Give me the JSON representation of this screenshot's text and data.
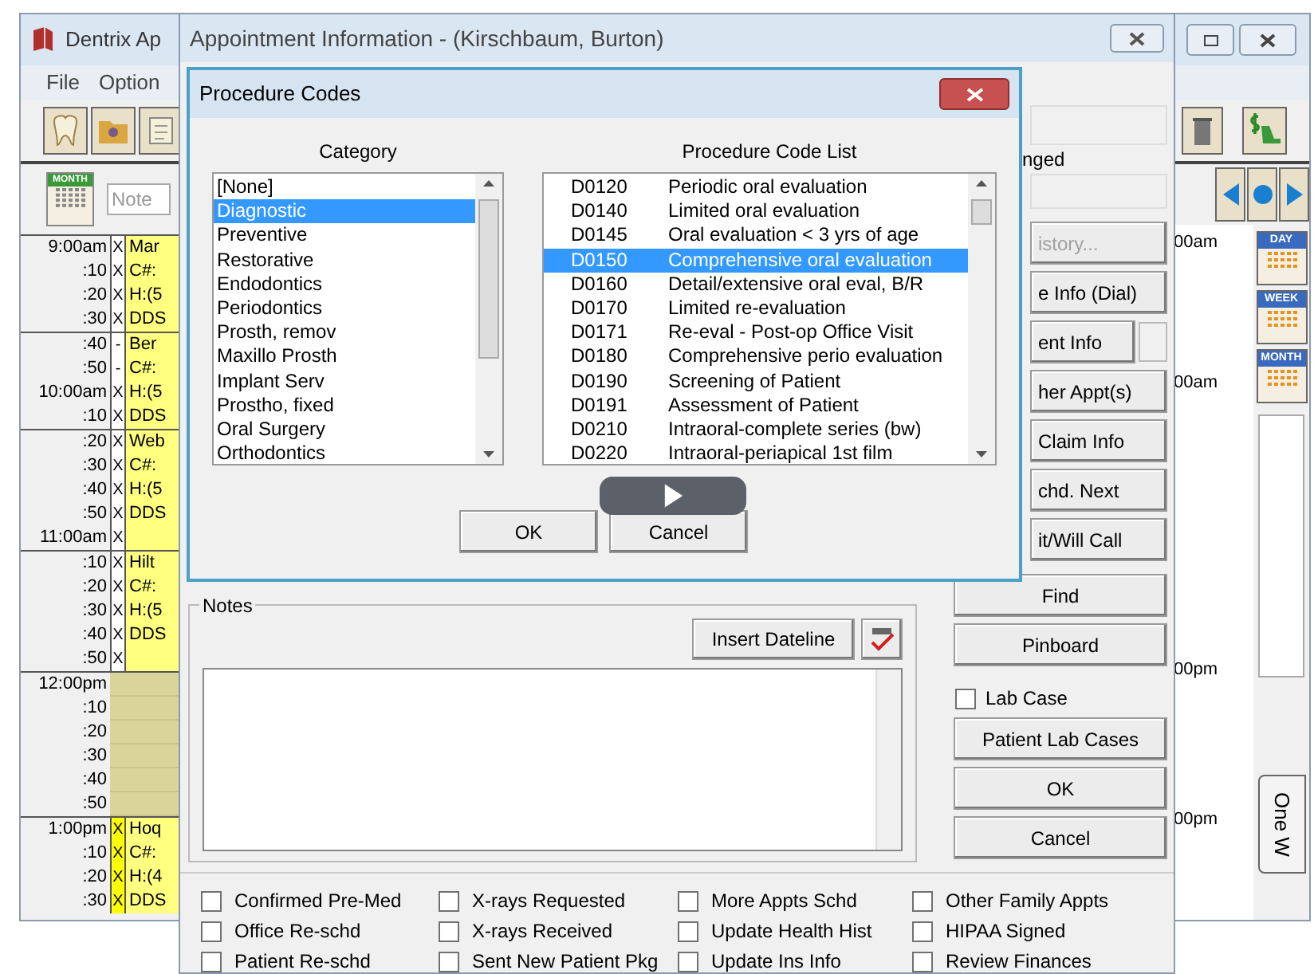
{
  "main_window": {
    "title": "Dentrix Ap",
    "menu": [
      "File",
      "Option"
    ],
    "month_button": "MONTH",
    "note_field": {
      "placeholder": "Note"
    },
    "schedule": [
      {
        "kind": "appt",
        "mark_highlight": false,
        "rows": [
          {
            "time": "9:00am",
            "mark": "X",
            "text": "Mar"
          },
          {
            "time": ":10",
            "mark": "X",
            "text": "C#:"
          },
          {
            "time": ":20",
            "mark": "X",
            "text": "H:(5"
          },
          {
            "time": ":30",
            "mark": "X",
            "text": "DDS"
          }
        ]
      },
      {
        "kind": "appt",
        "mark_highlight": false,
        "rows": [
          {
            "time": ":40",
            "mark": "-",
            "text": "Ber"
          },
          {
            "time": ":50",
            "mark": "-",
            "text": "C#:"
          },
          {
            "time": "10:00am",
            "mark": "X",
            "text": "H:(5"
          },
          {
            "time": ":10",
            "mark": "X",
            "text": "DDS"
          }
        ]
      },
      {
        "kind": "appt",
        "mark_highlight": false,
        "rows": [
          {
            "time": ":20",
            "mark": "X",
            "text": "Web"
          },
          {
            "time": ":30",
            "mark": "X",
            "text": "C#:"
          },
          {
            "time": ":40",
            "mark": "X",
            "text": "H:(5"
          },
          {
            "time": ":50",
            "mark": "X",
            "text": "DDS"
          },
          {
            "time": "11:00am",
            "mark": "X",
            "text": ""
          }
        ]
      },
      {
        "kind": "appt",
        "mark_highlight": false,
        "rows": [
          {
            "time": ":10",
            "mark": "X",
            "text": "Hilt"
          },
          {
            "time": ":20",
            "mark": "X",
            "text": "C#:"
          },
          {
            "time": ":30",
            "mark": "X",
            "text": "H:(5"
          },
          {
            "time": ":40",
            "mark": "X",
            "text": "DDS"
          },
          {
            "time": ":50",
            "mark": "X",
            "text": ""
          }
        ]
      },
      {
        "kind": "lunch",
        "rows": [
          {
            "time": "12:00pm",
            "mark": "",
            "text": ""
          },
          {
            "time": ":10",
            "mark": "",
            "text": ""
          },
          {
            "time": ":20",
            "mark": "",
            "text": ""
          },
          {
            "time": ":30",
            "mark": "",
            "text": ""
          },
          {
            "time": ":40",
            "mark": "",
            "text": ""
          },
          {
            "time": ":50",
            "mark": "",
            "text": ""
          }
        ]
      },
      {
        "kind": "appt",
        "mark_highlight": true,
        "rows": [
          {
            "time": "1:00pm",
            "mark": "X",
            "text": "Hoq"
          },
          {
            "time": ":10",
            "mark": "X",
            "text": "C#:"
          },
          {
            "time": ":20",
            "mark": "X",
            "text": "H:(4"
          },
          {
            "time": ":30",
            "mark": "X",
            "text": "DDS"
          }
        ]
      }
    ],
    "right_times": [
      "00am",
      "00am",
      "00pm",
      "00pm"
    ],
    "views": [
      "DAY",
      "WEEK",
      "MONTH"
    ],
    "tab": "One W"
  },
  "appointment_window": {
    "title": "Appointment Information - (Kirschbaum, Burton)",
    "partial_label": "nged",
    "buttons": [
      {
        "label": "istory...",
        "disabled": true
      },
      {
        "label": "e Info (Dial)",
        "disabled": false
      },
      {
        "label": "ent Info",
        "disabled": false
      },
      {
        "label": "her Appt(s)",
        "disabled": false
      },
      {
        "label": "Claim Info",
        "disabled": false
      },
      {
        "label": "chd. Next",
        "disabled": false
      },
      {
        "label": "it/Will Call",
        "disabled": false
      }
    ],
    "find_button": "Find",
    "pinboard_button": "Pinboard",
    "lab_case": {
      "label": "Lab Case",
      "checked": false
    },
    "bottom_buttons": [
      "Patient Lab Cases",
      "OK",
      "Cancel"
    ],
    "notes": {
      "title": "Notes",
      "insert_button": "Insert Dateline"
    },
    "checkboxes": [
      {
        "label": "Confirmed Pre-Med",
        "checked": false
      },
      {
        "label": "X-rays Requested",
        "checked": false
      },
      {
        "label": "More Appts Schd",
        "checked": false
      },
      {
        "label": "Other Family Appts",
        "checked": false
      },
      {
        "label": "Office Re-schd",
        "checked": false
      },
      {
        "label": "X-rays Received",
        "checked": false
      },
      {
        "label": "Update Health Hist",
        "checked": false
      },
      {
        "label": "HIPAA Signed",
        "checked": false
      },
      {
        "label": "Patient Re-schd",
        "checked": false
      },
      {
        "label": "Sent New Patient Pkg",
        "checked": false
      },
      {
        "label": "Update Ins Info",
        "checked": false
      },
      {
        "label": "Review Finances",
        "checked": false
      }
    ]
  },
  "procedure_dialog": {
    "title": "Procedure Codes",
    "category_header": "Category",
    "list_header": "Procedure Code List",
    "categories": [
      {
        "label": "[None]",
        "selected": false
      },
      {
        "label": "Diagnostic",
        "selected": true
      },
      {
        "label": "Preventive",
        "selected": false
      },
      {
        "label": "Restorative",
        "selected": false
      },
      {
        "label": "Endodontics",
        "selected": false
      },
      {
        "label": "Periodontics",
        "selected": false
      },
      {
        "label": "Prosth, remov",
        "selected": false
      },
      {
        "label": "Maxillo Prosth",
        "selected": false
      },
      {
        "label": "Implant Serv",
        "selected": false
      },
      {
        "label": "Prostho, fixed",
        "selected": false
      },
      {
        "label": "Oral Surgery",
        "selected": false
      },
      {
        "label": "Orthodontics",
        "selected": false
      }
    ],
    "codes": [
      {
        "code": "D0120",
        "description": "Periodic oral evaluation",
        "selected": false
      },
      {
        "code": "D0140",
        "description": "Limited oral evaluation",
        "selected": false
      },
      {
        "code": "D0145",
        "description": "Oral evaluation < 3 yrs of age",
        "selected": false
      },
      {
        "code": "D0150",
        "description": "Comprehensive oral evaluation",
        "selected": true
      },
      {
        "code": "D0160",
        "description": "Detail/extensive oral eval, B/R",
        "selected": false
      },
      {
        "code": "D0170",
        "description": "Limited re-evaluation",
        "selected": false
      },
      {
        "code": "D0171",
        "description": "Re-eval - Post-op Office Visit",
        "selected": false
      },
      {
        "code": "D0180",
        "description": "Comprehensive perio evaluation",
        "selected": false
      },
      {
        "code": "D0190",
        "description": "Screening of Patient",
        "selected": false
      },
      {
        "code": "D0191",
        "description": "Assessment of Patient",
        "selected": false
      },
      {
        "code": "D0210",
        "description": "Intraoral-complete series (bw)",
        "selected": false
      },
      {
        "code": "D0220",
        "description": "Intraoral-periapical 1st film",
        "selected": false
      }
    ],
    "buttons": [
      "OK",
      "Cancel"
    ]
  }
}
